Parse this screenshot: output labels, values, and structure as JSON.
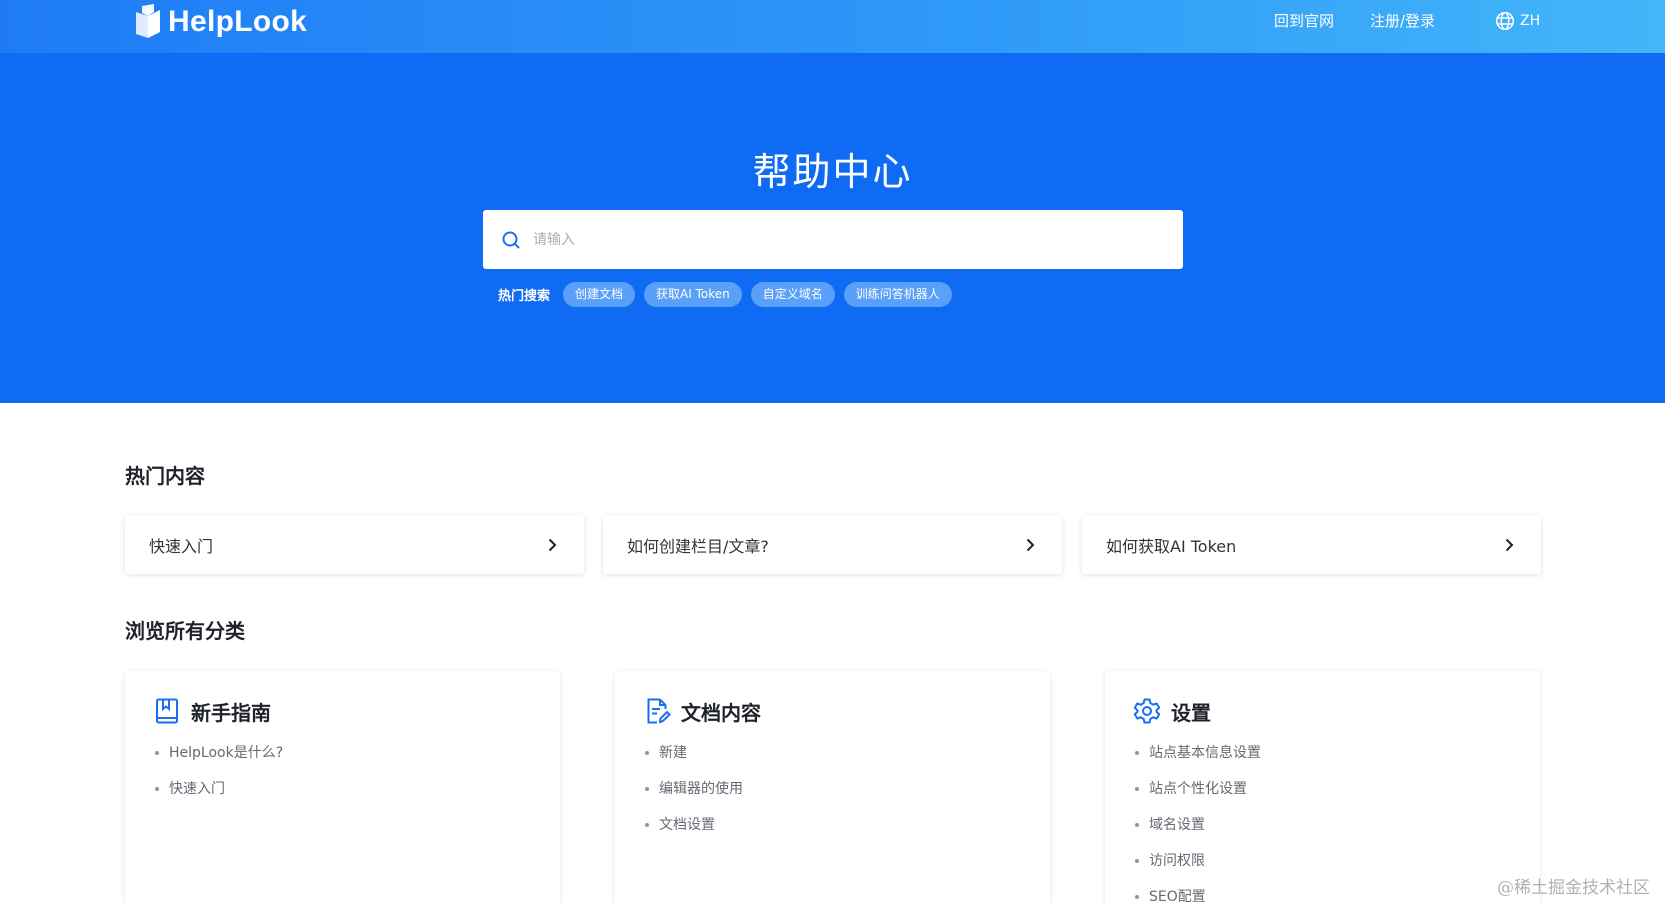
{
  "header": {
    "logo_text": "HelpLook",
    "nav_home": "回到官网",
    "nav_login": "注册/登录",
    "lang": "ZH"
  },
  "hero": {
    "title": "帮助中心",
    "search_placeholder": "请输入",
    "hot_label": "热门搜索",
    "hot_tags": [
      "创建文档",
      "获取AI Token",
      "自定义域名",
      "训练问答机器人"
    ]
  },
  "hot_section": {
    "title": "热门内容",
    "cards": [
      "快速入门",
      "如何创建栏目/文章?",
      "如何获取AI Token"
    ]
  },
  "categories_section": {
    "title": "浏览所有分类",
    "categories": [
      {
        "title": "新手指南",
        "icon": "book-icon",
        "items": [
          "HelpLook是什么?",
          "快速入门"
        ]
      },
      {
        "title": "文档内容",
        "icon": "document-edit-icon",
        "items": [
          "新建",
          "编辑器的使用",
          "文档设置"
        ]
      },
      {
        "title": "设置",
        "icon": "gear-icon",
        "items": [
          "站点基本信息设置",
          "站点个性化设置",
          "域名设置",
          "访问权限",
          "SEO配置"
        ]
      }
    ]
  },
  "watermark": "@稀土掘金技术社区",
  "colors": {
    "hero_bg": "#0f6bf4",
    "accent": "#1a6ff0",
    "tag_bg": "#5aa0f8"
  }
}
